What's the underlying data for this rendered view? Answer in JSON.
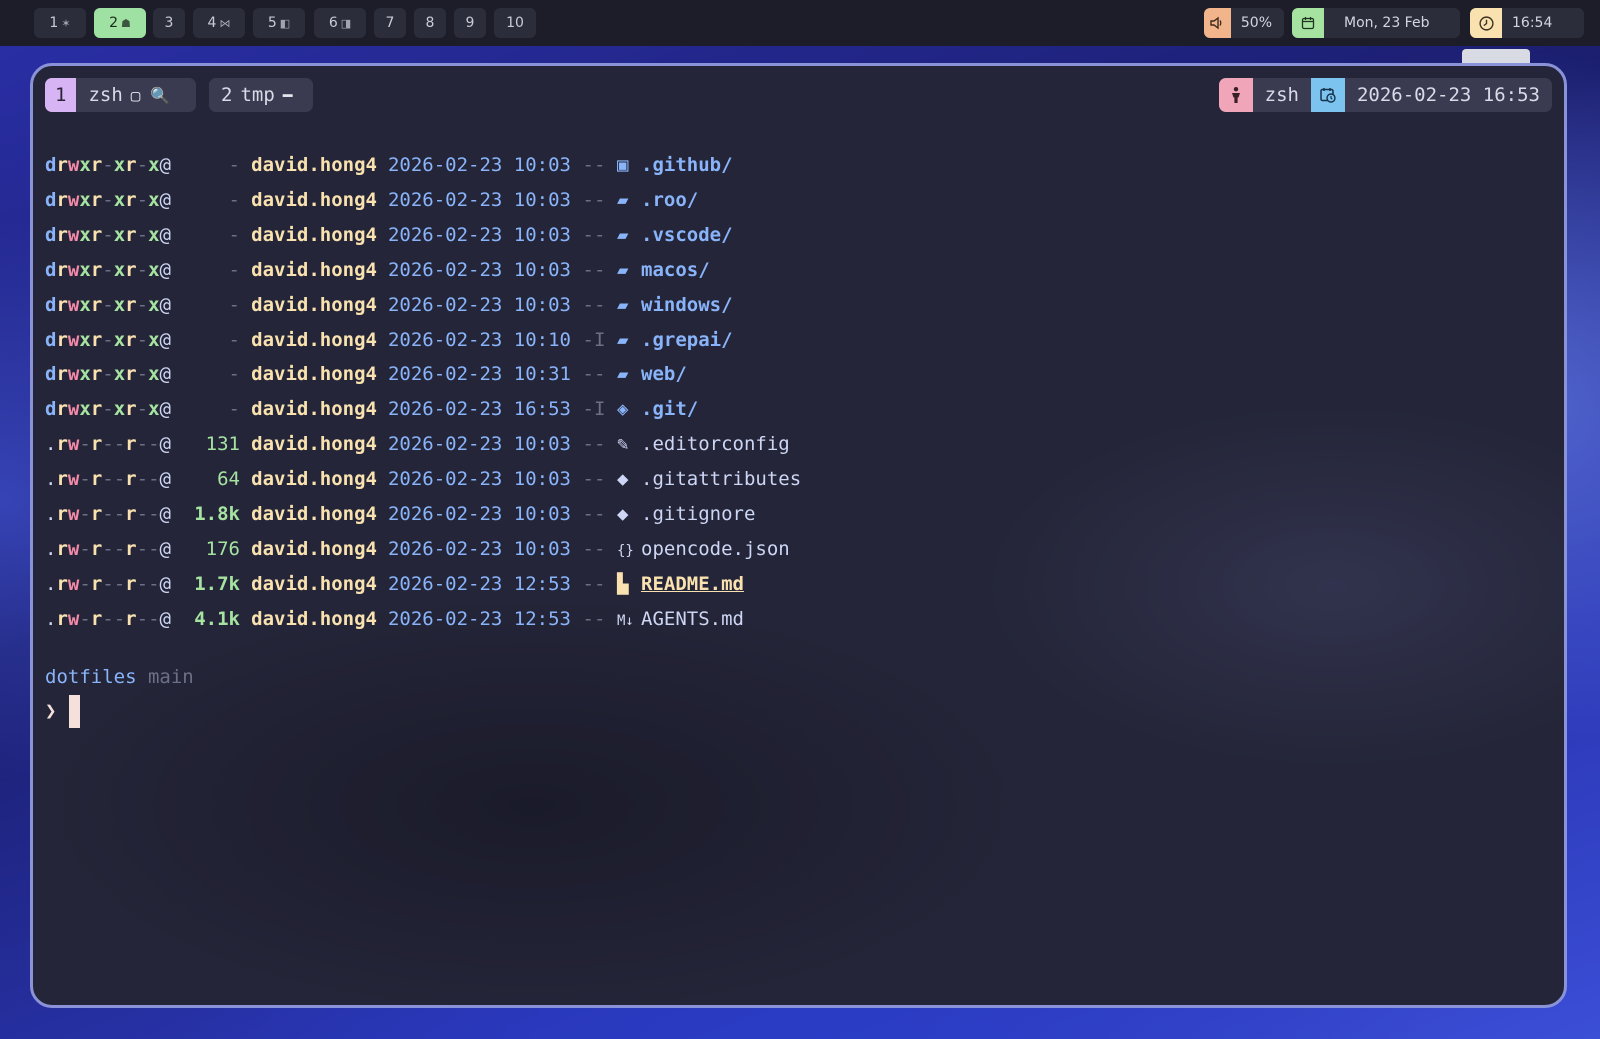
{
  "workspaces": [
    {
      "num": "1",
      "icon": "✶",
      "active": false
    },
    {
      "num": "2",
      "icon": "☗",
      "active": true
    },
    {
      "num": "3",
      "icon": "",
      "active": false
    },
    {
      "num": "4",
      "icon": "⋈",
      "active": false
    },
    {
      "num": "5",
      "icon": "◧",
      "active": false
    },
    {
      "num": "6",
      "icon": "◨",
      "active": false
    },
    {
      "num": "7",
      "icon": "",
      "active": false
    },
    {
      "num": "8",
      "icon": "",
      "active": false
    },
    {
      "num": "9",
      "icon": "",
      "active": false
    },
    {
      "num": "10",
      "icon": "",
      "active": false
    }
  ],
  "status": {
    "volume": {
      "icon": "speaker-icon",
      "value": "50%",
      "color": "#f2b48a"
    },
    "date": {
      "icon": "calendar-icon",
      "value": "Mon, 23 Feb",
      "color": "#a6e3a1"
    },
    "clock": {
      "icon": "clock-icon",
      "value": "16:54",
      "color": "#f9e2af"
    }
  },
  "terminal": {
    "tabs": [
      {
        "num": "1",
        "name": "zsh",
        "icons": "▢ 🔍",
        "active": true
      },
      {
        "num": "2",
        "name": "tmp",
        "icons": "━",
        "active": false
      }
    ],
    "right_status": {
      "user_icon": "person-icon",
      "shell": "zsh",
      "datetime_icon": "calendar-clock-icon",
      "datetime": "2026-02-23 16:53"
    },
    "listing": [
      {
        "perm": "drwxr-xr-x@",
        "size": "-",
        "user": "david.hong4",
        "date": "2026-02-23 10:03",
        "git": "--",
        "icon": "folder-github-icon",
        "glyph": "▣",
        "name": ".github/",
        "type": "dir"
      },
      {
        "perm": "drwxr-xr-x@",
        "size": "-",
        "user": "david.hong4",
        "date": "2026-02-23 10:03",
        "git": "--",
        "icon": "folder-icon",
        "glyph": "▰",
        "name": ".roo/",
        "type": "dir"
      },
      {
        "perm": "drwxr-xr-x@",
        "size": "-",
        "user": "david.hong4",
        "date": "2026-02-23 10:03",
        "git": "--",
        "icon": "folder-icon",
        "glyph": "▰",
        "name": ".vscode/",
        "type": "dir"
      },
      {
        "perm": "drwxr-xr-x@",
        "size": "-",
        "user": "david.hong4",
        "date": "2026-02-23 10:03",
        "git": "--",
        "icon": "folder-icon",
        "glyph": "▰",
        "name": "macos/",
        "type": "dir"
      },
      {
        "perm": "drwxr-xr-x@",
        "size": "-",
        "user": "david.hong4",
        "date": "2026-02-23 10:03",
        "git": "--",
        "icon": "folder-icon",
        "glyph": "▰",
        "name": "windows/",
        "type": "dir"
      },
      {
        "perm": "drwxr-xr-x@",
        "size": "-",
        "user": "david.hong4",
        "date": "2026-02-23 10:10",
        "git": "-I",
        "icon": "folder-icon",
        "glyph": "▰",
        "name": ".grepai/",
        "type": "dir"
      },
      {
        "perm": "drwxr-xr-x@",
        "size": "-",
        "user": "david.hong4",
        "date": "2026-02-23 10:31",
        "git": "--",
        "icon": "folder-icon",
        "glyph": "▰",
        "name": "web/",
        "type": "dir"
      },
      {
        "perm": "drwxr-xr-x@",
        "size": "-",
        "user": "david.hong4",
        "date": "2026-02-23 16:53",
        "git": "-I",
        "icon": "folder-git-icon",
        "glyph": "◈",
        "name": ".git/",
        "type": "dir"
      },
      {
        "perm": ".rw-r--r--@",
        "size": "131",
        "user": "david.hong4",
        "date": "2026-02-23 10:03",
        "git": "--",
        "icon": "editorconfig-icon",
        "glyph": "✎",
        "name": ".editorconfig",
        "type": "file"
      },
      {
        "perm": ".rw-r--r--@",
        "size": "64",
        "user": "david.hong4",
        "date": "2026-02-23 10:03",
        "git": "--",
        "icon": "git-icon",
        "glyph": "◆",
        "name": ".gitattributes",
        "type": "file"
      },
      {
        "perm": ".rw-r--r--@",
        "size": "1.8k",
        "user": "david.hong4",
        "date": "2026-02-23 10:03",
        "git": "--",
        "icon": "git-icon",
        "glyph": "◆",
        "name": ".gitignore",
        "type": "file"
      },
      {
        "perm": ".rw-r--r--@",
        "size": "176",
        "user": "david.hong4",
        "date": "2026-02-23 10:03",
        "git": "--",
        "icon": "json-icon",
        "glyph": "{}",
        "name": "opencode.json",
        "type": "file"
      },
      {
        "perm": ".rw-r--r--@",
        "size": "1.7k",
        "user": "david.hong4",
        "date": "2026-02-23 12:53",
        "git": "--",
        "icon": "book-icon",
        "glyph": "▙",
        "name": "README.md",
        "type": "readme"
      },
      {
        "perm": ".rw-r--r--@",
        "size": "4.1k",
        "user": "david.hong4",
        "date": "2026-02-23 12:53",
        "git": "--",
        "icon": "markdown-icon",
        "glyph": "M↓",
        "name": "AGENTS.md",
        "type": "file"
      }
    ],
    "prompt": {
      "dir": "dotfiles",
      "branch": "main",
      "symbol": "❯"
    }
  }
}
